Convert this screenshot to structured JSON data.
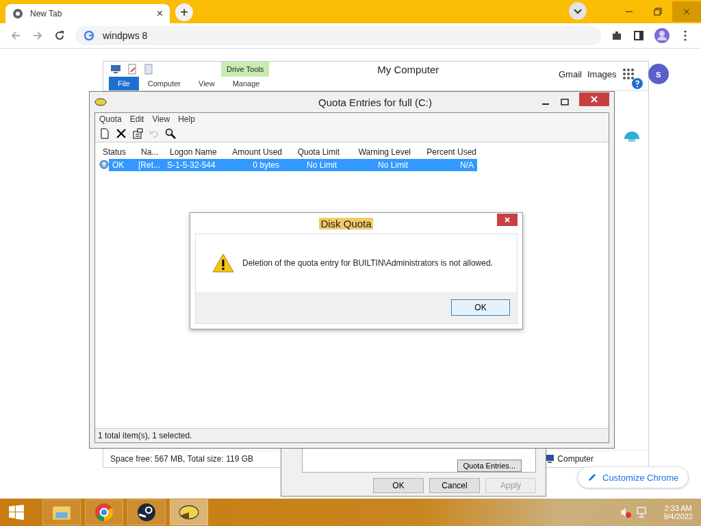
{
  "browser": {
    "tab": {
      "title": "New Tab",
      "close": "×",
      "new_tab": "+"
    },
    "address": "windpws 8",
    "page_links": [
      "Gmail",
      "Images"
    ],
    "avatar": "s",
    "customize": "Customize Chrome"
  },
  "explorer": {
    "title": "My Computer",
    "context_tab": "Drive Tools",
    "ribbon_tabs": [
      {
        "label": "File",
        "selected": true
      },
      {
        "label": "Computer",
        "selected": false
      },
      {
        "label": "View",
        "selected": false
      },
      {
        "label": "Manage",
        "selected": false
      }
    ],
    "status": "Space free: 567 MB, Total size: 119 GB",
    "location": "Computer"
  },
  "properties": {
    "quota_button": "Quota Entries...",
    "buttons": [
      {
        "label": "OK",
        "disabled": false
      },
      {
        "label": "Cancel",
        "disabled": false
      },
      {
        "label": "Apply",
        "disabled": true
      }
    ]
  },
  "quota_window": {
    "title": "Quota Entries for full (C:)",
    "menu": [
      "Quota",
      "Edit",
      "View",
      "Help"
    ],
    "columns": [
      "Status",
      "Na...",
      "Logon Name",
      "Amount Used",
      "Quota Limit",
      "Warning Level",
      "Percent Used"
    ],
    "rows": [
      {
        "cells": [
          "OK",
          "[Ret...",
          "S-1-5-32-544",
          "0 bytes",
          "No Limit",
          "No Limit",
          "N/A"
        ],
        "selected": true
      }
    ],
    "status": "1 total item(s), 1 selected."
  },
  "dialog": {
    "title": "Disk Quota",
    "message": "Deletion of the quota entry for BUILTIN\\Administrators is not allowed.",
    "button": "OK"
  },
  "taskbar": {
    "time": "2:33 AM",
    "date": "9/4/2022"
  }
}
